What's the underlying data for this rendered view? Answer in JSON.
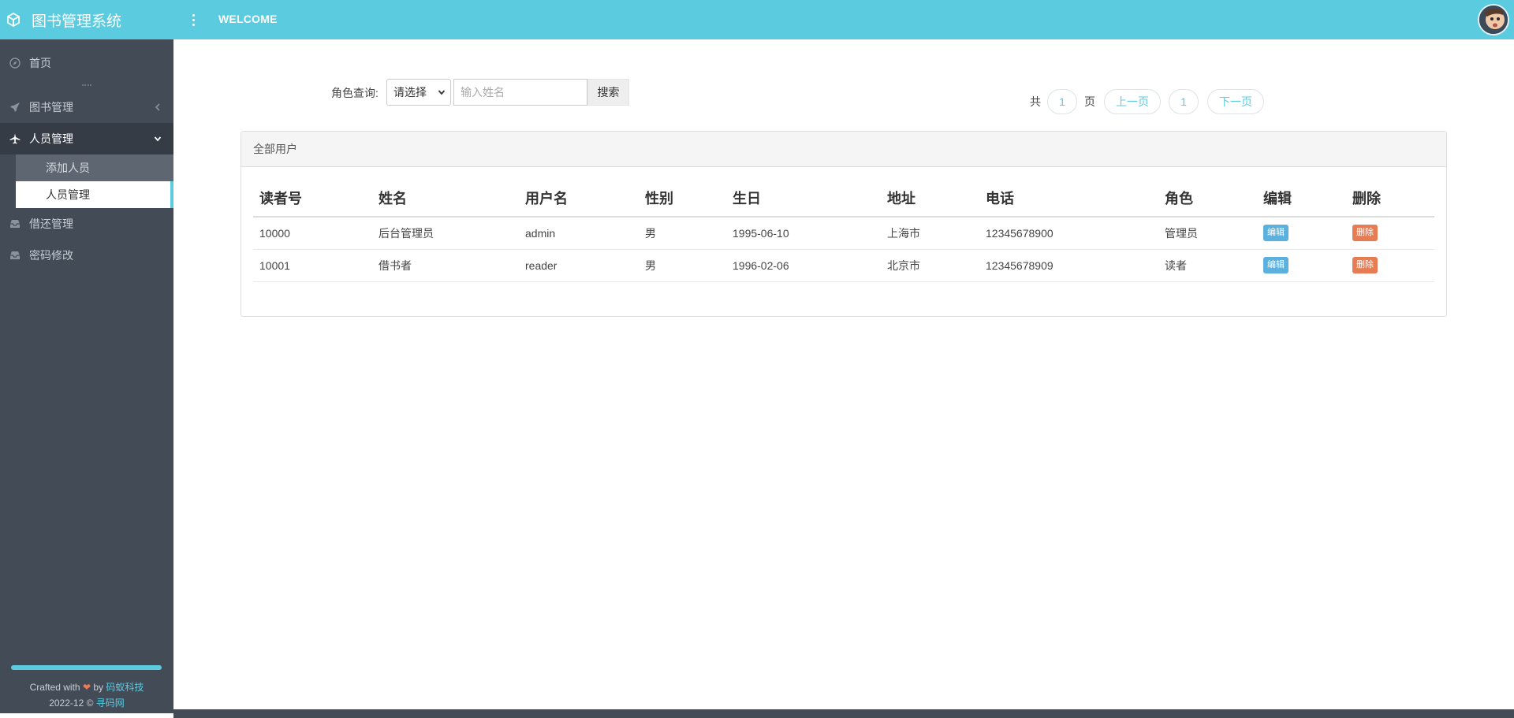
{
  "app": {
    "title": "图书管理系统",
    "welcome": "WELCOME"
  },
  "sidebar": {
    "items": [
      {
        "label": "首页",
        "icon": "compass-icon"
      },
      {
        "label": "图书管理",
        "icon": "rocket-icon"
      },
      {
        "label": "人员管理",
        "icon": "plane-icon"
      },
      {
        "label": "借还管理",
        "icon": "inbox-icon"
      },
      {
        "label": "密码修改",
        "icon": "inbox-icon"
      }
    ],
    "sub_items": [
      {
        "label": "添加人员"
      },
      {
        "label": "人员管理"
      }
    ],
    "footer": {
      "crafted": "Crafted with",
      "by": "by",
      "company": "码蚁科技",
      "year": "2022-12 ©",
      "site": "寻码网"
    }
  },
  "search": {
    "label": "角色查询:",
    "select_value": "请选择",
    "input_placeholder": "输入姓名",
    "button": "搜索"
  },
  "pagination": {
    "total_prefix": "共",
    "total_pages": "1",
    "total_suffix": "页",
    "prev": "上一页",
    "current": "1",
    "next": "下一页"
  },
  "panel": {
    "title": "全部用户"
  },
  "table": {
    "headers": [
      "读者号",
      "姓名",
      "用户名",
      "性别",
      "生日",
      "地址",
      "电话",
      "角色",
      "编辑",
      "删除"
    ],
    "edit_label": "编辑",
    "delete_label": "删除",
    "rows": [
      {
        "id": "10000",
        "name": "后台管理员",
        "username": "admin",
        "gender": "男",
        "birthday": "1995-06-10",
        "address": "上海市",
        "phone": "12345678900",
        "role": "管理员"
      },
      {
        "id": "10001",
        "name": "借书者",
        "username": "reader",
        "gender": "男",
        "birthday": "1996-02-06",
        "address": "北京市",
        "phone": "12345678909",
        "role": "读者"
      }
    ]
  },
  "colors": {
    "accent": "#5bcbe0",
    "sidebar": "#434b57",
    "edit": "#5bb0de",
    "delete": "#e77b52"
  }
}
